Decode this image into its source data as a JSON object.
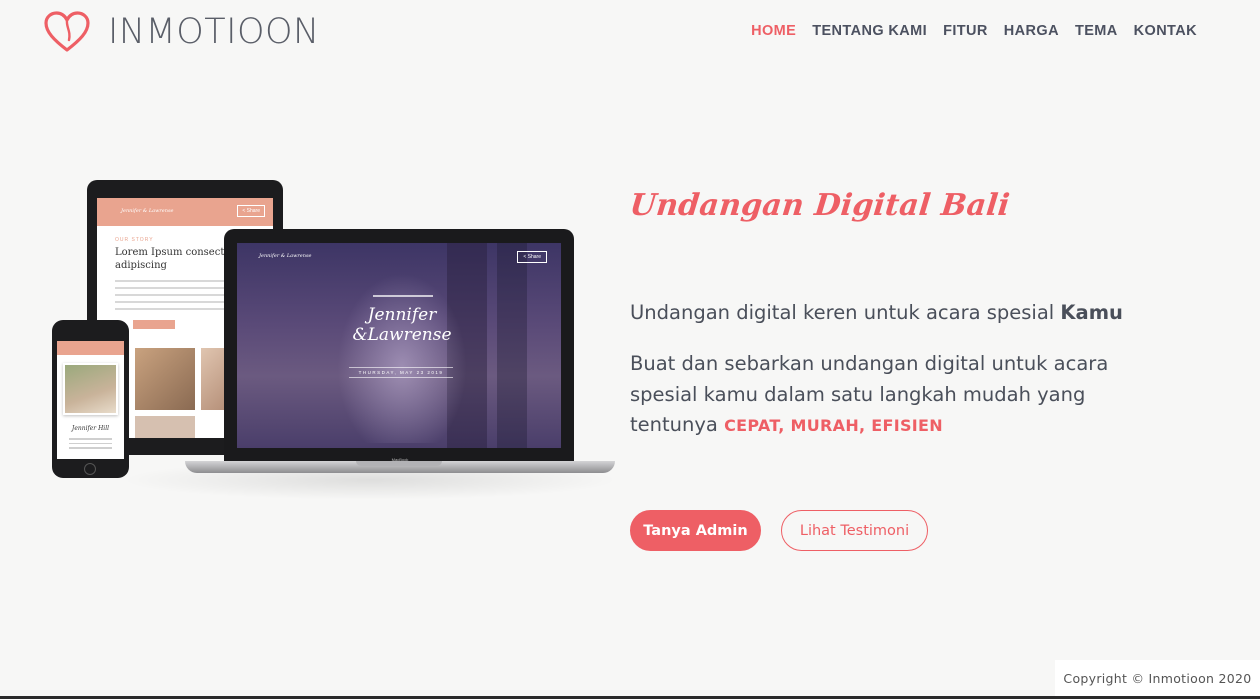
{
  "brand": {
    "name": "INMOTIOON",
    "accent_color": "#ee5f65",
    "logo_icon": "heart-icon"
  },
  "nav": {
    "items": [
      {
        "label": "HOME",
        "active": true
      },
      {
        "label": "TENTANG KAMI",
        "active": false
      },
      {
        "label": "FITUR",
        "active": false
      },
      {
        "label": "HARGA",
        "active": false
      },
      {
        "label": "TEMA",
        "active": false
      },
      {
        "label": "KONTAK",
        "active": false
      }
    ]
  },
  "mockup": {
    "tablet": {
      "couple_name": "Jennifer & Lawrense",
      "share_label": "< Share",
      "section_label": "OUR STORY",
      "heading": "Lorem Ipsum consectetur adipiscing"
    },
    "laptop": {
      "couple_name": "Jennifer & Lawrense",
      "share_label": "< Share",
      "title": "Jennifer &Lawrense",
      "date": "THURSDAY, MAY 23 2019",
      "brand_label": "MacBook"
    },
    "phone": {
      "name": "Jennifer Hill"
    }
  },
  "hero": {
    "title": "Undangan Digital Bali",
    "line1_text": "Undangan digital keren untuk acara spesial ",
    "line1_bold": "Kamu",
    "para_text": "Buat dan sebarkan undangan digital untuk acara spesial kamu dalam satu langkah mudah yang tentunya ",
    "para_highlight": "CEPAT, MURAH, EFISIEN"
  },
  "buttons": {
    "primary": "Tanya Admin",
    "secondary": "Lihat Testimoni"
  },
  "footer": {
    "copyright": "Copyright © Inmotioon 2020"
  }
}
